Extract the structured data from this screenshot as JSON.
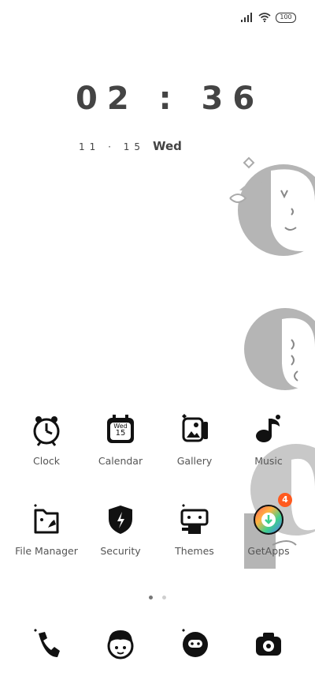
{
  "status": {
    "battery": "100",
    "signal_icon": "signal-icon",
    "wifi_icon": "wifi-icon"
  },
  "lock": {
    "time": "02 : 36",
    "date": "11 · 15",
    "weekday": "Wed"
  },
  "apps_row1": [
    {
      "label": "Clock",
      "icon": "clock-icon"
    },
    {
      "label": "Calendar",
      "icon": "calendar-icon",
      "cal_day": "Wed",
      "cal_num": "15"
    },
    {
      "label": "Gallery",
      "icon": "gallery-icon"
    },
    {
      "label": "Music",
      "icon": "music-icon"
    }
  ],
  "apps_row2": [
    {
      "label": "File Manager",
      "icon": "file-manager-icon"
    },
    {
      "label": "Security",
      "icon": "security-icon"
    },
    {
      "label": "Themes",
      "icon": "themes-icon"
    },
    {
      "label": "GetApps",
      "icon": "getapps-icon",
      "badge": "4"
    }
  ],
  "dock": [
    {
      "icon": "phone-icon"
    },
    {
      "icon": "contacts-icon"
    },
    {
      "icon": "messages-icon"
    },
    {
      "icon": "camera-icon"
    }
  ],
  "pager": {
    "pages": 2,
    "active": 0
  },
  "colors": {
    "badge": "#ff5a1f",
    "wallpaper_gray": "#b5b5b5"
  }
}
